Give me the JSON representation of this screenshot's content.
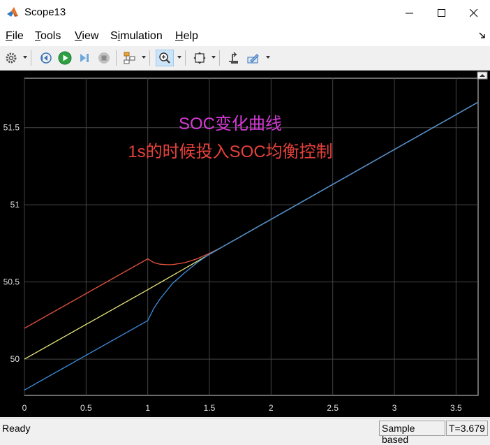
{
  "window": {
    "title": "Scope13"
  },
  "menu": [
    {
      "pre": "",
      "u": "F",
      "post": "ile"
    },
    {
      "pre": "",
      "u": "T",
      "post": "ools"
    },
    {
      "pre": "",
      "u": "V",
      "post": "iew"
    },
    {
      "pre": "S",
      "u": "i",
      "post": "mulation"
    },
    {
      "pre": "",
      "u": "H",
      "post": "elp"
    }
  ],
  "toolbar": {
    "icons": [
      "gear-icon",
      "step-back-icon",
      "run-icon",
      "step-forward-icon",
      "stop-icon",
      "signal-select-icon",
      "zoom-icon",
      "fit-to-view-icon",
      "triggers-icon",
      "edit-icon"
    ],
    "active": "zoom-icon"
  },
  "annotations": {
    "line1": "SOC变化曲线",
    "line2": "1s的时候投入SOC均衡控制",
    "line1_color": "#d63ad6",
    "line2_color": "#e8413a"
  },
  "status": {
    "left": "Ready",
    "mode": "Sample based",
    "time": "T=3.679"
  },
  "chart_data": {
    "type": "line",
    "xlim": [
      0,
      3.679
    ],
    "ylim": [
      49.765,
      51.82
    ],
    "xticks": [
      0,
      0.5,
      1,
      1.5,
      2,
      2.5,
      3,
      3.5
    ],
    "xtick_labels": [
      "0",
      "0.5",
      "1",
      "1.5",
      "2",
      "2.5",
      "3",
      "3.5"
    ],
    "yticks": [
      50,
      50.5,
      51,
      51.5
    ],
    "ytick_labels": [
      "50",
      "50.5",
      "51",
      "51.5"
    ],
    "grid": true,
    "background": "#000000",
    "series": [
      {
        "color": "#e8553e",
        "x": [
          0,
          1,
          1.05,
          1.1,
          1.15,
          1.2,
          1.3,
          1.4,
          1.5,
          1.6,
          3.679
        ],
        "y": [
          50.2,
          50.65,
          50.625,
          50.615,
          50.612,
          50.612,
          50.625,
          50.65,
          50.685,
          50.725,
          51.665
        ]
      },
      {
        "color": "#e6e67a",
        "x": [
          0,
          1,
          1.6,
          3.679
        ],
        "y": [
          50.0,
          50.45,
          50.725,
          51.665
        ]
      },
      {
        "color": "#3f8ee0",
        "x": [
          0,
          1,
          1.05,
          1.1,
          1.15,
          1.2,
          1.3,
          1.4,
          1.5,
          1.6,
          3.679
        ],
        "y": [
          49.8,
          50.25,
          50.33,
          50.39,
          50.44,
          50.49,
          50.56,
          50.625,
          50.68,
          50.725,
          51.665
        ]
      }
    ]
  }
}
